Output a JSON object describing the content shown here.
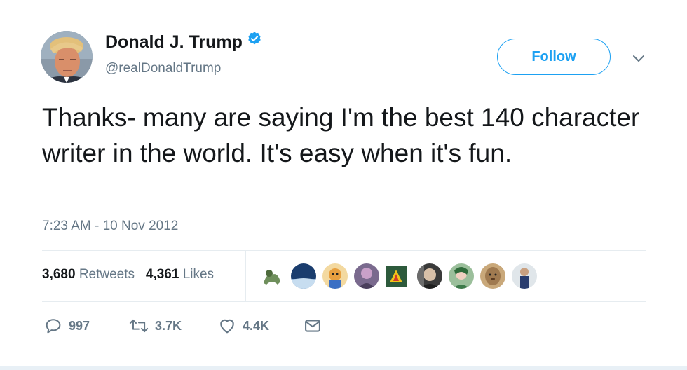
{
  "author": {
    "name": "Donald J. Trump",
    "handle": "@realDonaldTrump",
    "verified": true
  },
  "follow_button": {
    "label": "Follow"
  },
  "tweet": {
    "text": "Thanks- many are saying I'm the best 140 character writer in the world. It's easy when it's fun.",
    "timestamp": "7:23 AM - 10 Nov 2012"
  },
  "stats": {
    "retweets_count": "3,680",
    "retweets_label": "Retweets",
    "likes_count": "4,361",
    "likes_label": "Likes"
  },
  "liker_avatars": 9,
  "actions": {
    "reply_count": "997",
    "retweet_count": "3.7K",
    "like_count": "4.4K"
  },
  "colors": {
    "accent": "#1da1f2",
    "secondary_text": "#657786",
    "primary_text": "#14171a",
    "divider": "#e6ecf0"
  }
}
